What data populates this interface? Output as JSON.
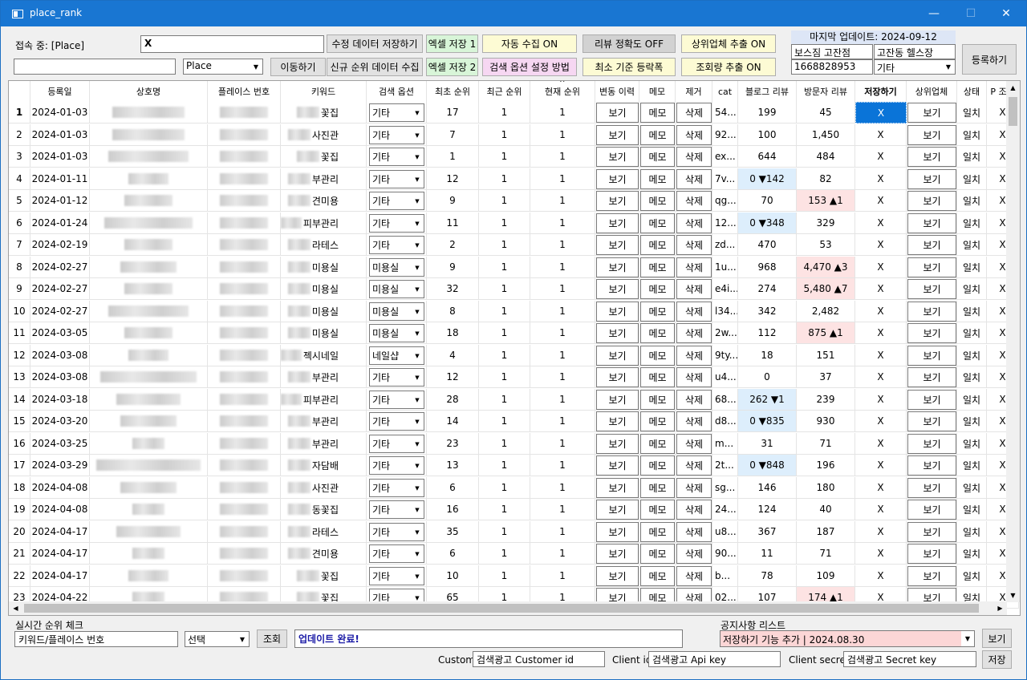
{
  "window": {
    "title": "place_rank",
    "min": "—",
    "max": "☐",
    "close": "✕"
  },
  "top": {
    "conn_label": "접속 중: [Place]",
    "main_input": "X",
    "sub_input": "",
    "place_select": "Place",
    "btn_save_mod": "수정 데이터 저장하기",
    "btn_move": "이동하기",
    "btn_new_rank": "신규 순위 데이터 수집",
    "btn_excel1": "엑셀 저장 1",
    "btn_excel2": "엑셀 저장 2",
    "btn_auto": "자동 수집 ON",
    "btn_search_opt": "검색 옵션 설정 방법",
    "btn_review": "리뷰 정확도 OFF",
    "btn_min_rank": "최소 기준 등락폭",
    "btn_top_ext": "상위업체 추출 ON",
    "btn_views": "조회량 추출 ON",
    "last_update": "마지막 업데이트: 2024-09-12",
    "store_name": "보스짐 고잔점",
    "store_cat": "고잔동 헬스장",
    "store_id": "1668828953",
    "store_sel": "기타",
    "btn_register": "등록하기"
  },
  "columns": [
    "",
    "등록일",
    "상호명",
    "플레이스 번호",
    "키워드",
    "검색 옵션",
    "최초 순위",
    "최근 순위",
    "현재 순위",
    "변동 이력",
    "메모",
    "제거",
    "cat",
    "블로그 리뷰",
    "방문자 리뷰",
    "저장하기",
    "상위업체",
    "상태",
    "P 조회"
  ],
  "sort_arrow": "^",
  "cell_labels": {
    "view": "보기",
    "memo": "메모",
    "delete": "삭제",
    "x": "X"
  },
  "rows": [
    {
      "n": "1",
      "date": "2024-01-03",
      "kw": "꽃집",
      "opt": "기타",
      "first": "17",
      "recent": "1",
      "cur": "1",
      "cat": "54...",
      "blog": "199",
      "visit": "45",
      "status": "일치"
    },
    {
      "n": "2",
      "date": "2024-01-03",
      "kw": "사진관",
      "opt": "기타",
      "first": "7",
      "recent": "1",
      "cur": "1",
      "cat": "92...",
      "blog": "100",
      "visit": "1,450",
      "status": "일치"
    },
    {
      "n": "3",
      "date": "2024-01-03",
      "kw": "꽃집",
      "opt": "기타",
      "first": "1",
      "recent": "1",
      "cur": "1",
      "cat": "ex...",
      "blog": "644",
      "visit": "484",
      "status": "일치"
    },
    {
      "n": "4",
      "date": "2024-01-11",
      "kw": "부관리",
      "opt": "기타",
      "first": "12",
      "recent": "1",
      "cur": "1",
      "cat": "7v...",
      "blog": "0 ▼142",
      "visit": "82",
      "status": "일치",
      "blogc": "blue"
    },
    {
      "n": "5",
      "date": "2024-01-12",
      "kw": "견미용",
      "opt": "기타",
      "first": "9",
      "recent": "1",
      "cur": "1",
      "cat": "qg...",
      "blog": "70",
      "visit": "153 ▲1",
      "status": "일치",
      "visitc": "pink"
    },
    {
      "n": "6",
      "date": "2024-01-24",
      "kw": "피부관리",
      "opt": "기타",
      "first": "11",
      "recent": "1",
      "cur": "1",
      "cat": "12...",
      "blog": "0 ▼348",
      "visit": "329",
      "status": "일치",
      "blogc": "blue"
    },
    {
      "n": "7",
      "date": "2024-02-19",
      "kw": "라테스",
      "opt": "기타",
      "first": "2",
      "recent": "1",
      "cur": "1",
      "cat": "zd...",
      "blog": "470",
      "visit": "53",
      "status": "일치"
    },
    {
      "n": "8",
      "date": "2024-02-27",
      "kw": "미용실",
      "opt": "미용실",
      "first": "9",
      "recent": "1",
      "cur": "1",
      "cat": "1u...",
      "blog": "968",
      "visit": "4,470 ▲3",
      "status": "일치",
      "visitc": "pink"
    },
    {
      "n": "9",
      "date": "2024-02-27",
      "kw": "미용실",
      "opt": "미용실",
      "first": "32",
      "recent": "1",
      "cur": "1",
      "cat": "e4i...",
      "blog": "274",
      "visit": "5,480 ▲7",
      "status": "일치",
      "visitc": "pink"
    },
    {
      "n": "10",
      "date": "2024-02-27",
      "kw": "미용실",
      "opt": "미용실",
      "first": "8",
      "recent": "1",
      "cur": "1",
      "cat": "l34...",
      "blog": "342",
      "visit": "2,482",
      "status": "일치"
    },
    {
      "n": "11",
      "date": "2024-03-05",
      "kw": "미용실",
      "opt": "미용실",
      "first": "18",
      "recent": "1",
      "cur": "1",
      "cat": "2w...",
      "blog": "112",
      "visit": "875 ▲1",
      "status": "일치",
      "visitc": "pink"
    },
    {
      "n": "12",
      "date": "2024-03-08",
      "kw": "젝시네일",
      "opt": "네일샵",
      "first": "4",
      "recent": "1",
      "cur": "1",
      "cat": "9ty...",
      "blog": "18",
      "visit": "151",
      "status": "일치"
    },
    {
      "n": "13",
      "date": "2024-03-08",
      "kw": "부관리",
      "opt": "기타",
      "first": "12",
      "recent": "1",
      "cur": "1",
      "cat": "u4...",
      "blog": "0",
      "visit": "37",
      "status": "일치"
    },
    {
      "n": "14",
      "date": "2024-03-18",
      "kw": "피부관리",
      "opt": "기타",
      "first": "28",
      "recent": "1",
      "cur": "1",
      "cat": "68...",
      "blog": "262 ▼1",
      "visit": "239",
      "status": "일치",
      "blogc": "blue"
    },
    {
      "n": "15",
      "date": "2024-03-20",
      "kw": "부관리",
      "opt": "기타",
      "first": "14",
      "recent": "1",
      "cur": "1",
      "cat": "d8...",
      "blog": "0 ▼835",
      "visit": "930",
      "status": "일치",
      "blogc": "blue"
    },
    {
      "n": "16",
      "date": "2024-03-25",
      "kw": "부관리",
      "opt": "기타",
      "first": "23",
      "recent": "1",
      "cur": "1",
      "cat": "m...",
      "blog": "31",
      "visit": "71",
      "status": "일치"
    },
    {
      "n": "17",
      "date": "2024-03-29",
      "kw": "자담배",
      "opt": "기타",
      "first": "13",
      "recent": "1",
      "cur": "1",
      "cat": "2t...",
      "blog": "0 ▼848",
      "visit": "196",
      "status": "일치",
      "blogc": "blue"
    },
    {
      "n": "18",
      "date": "2024-04-08",
      "kw": "사진관",
      "opt": "기타",
      "first": "6",
      "recent": "1",
      "cur": "1",
      "cat": "sg...",
      "blog": "146",
      "visit": "180",
      "status": "일치"
    },
    {
      "n": "19",
      "date": "2024-04-08",
      "kw": "동꽃집",
      "opt": "기타",
      "first": "16",
      "recent": "1",
      "cur": "1",
      "cat": "24...",
      "blog": "124",
      "visit": "40",
      "status": "일치"
    },
    {
      "n": "20",
      "date": "2024-04-17",
      "kw": "라테스",
      "opt": "기타",
      "first": "35",
      "recent": "1",
      "cur": "1",
      "cat": "u8...",
      "blog": "367",
      "visit": "187",
      "status": "일치"
    },
    {
      "n": "21",
      "date": "2024-04-17",
      "kw": "견미용",
      "opt": "기타",
      "first": "6",
      "recent": "1",
      "cur": "1",
      "cat": "90...",
      "blog": "11",
      "visit": "71",
      "status": "일치"
    },
    {
      "n": "22",
      "date": "2024-04-17",
      "kw": "꽃집",
      "opt": "기타",
      "first": "10",
      "recent": "1",
      "cur": "1",
      "cat": "b...",
      "blog": "78",
      "visit": "109",
      "status": "일치"
    },
    {
      "n": "23",
      "date": "2024-04-22",
      "kw": "꽃집",
      "opt": "기타",
      "first": "65",
      "recent": "1",
      "cur": "1",
      "cat": "02...",
      "blog": "107",
      "visit": "174 ▲1",
      "status": "일치",
      "visitc": "pink"
    }
  ],
  "bottom": {
    "realtime_label": "실시간 순위 체크",
    "kw_input": "키워드/플레이스 번호",
    "kw_select": "선택",
    "btn_query": "조회",
    "status_msg": "업데이트 완료!",
    "notice_label": "공지사항 리스트",
    "notice_select": "저장하기 기능 추가 | 2024.08.30",
    "btn_notice_view": "보기",
    "custom_label": "Custom",
    "custom_input": "검색광고 Customer id",
    "client_id_label": "Client id",
    "client_id_input": "검색광고 Api key",
    "client_secret_label": "Client secret",
    "client_secret_input": "검색광고 Secret key",
    "btn_save": "저장"
  },
  "colors": {
    "titlebar": "#1976d2",
    "green_btn": "#d8f5d8",
    "yellow_btn": "#fdfbd4",
    "pink_btn": "#f6d7f2",
    "gray_btn": "#d2d2d2",
    "blue_cell": "#ddeefc",
    "pink_cell": "#fde3e3",
    "selected": "#0a74d8"
  }
}
